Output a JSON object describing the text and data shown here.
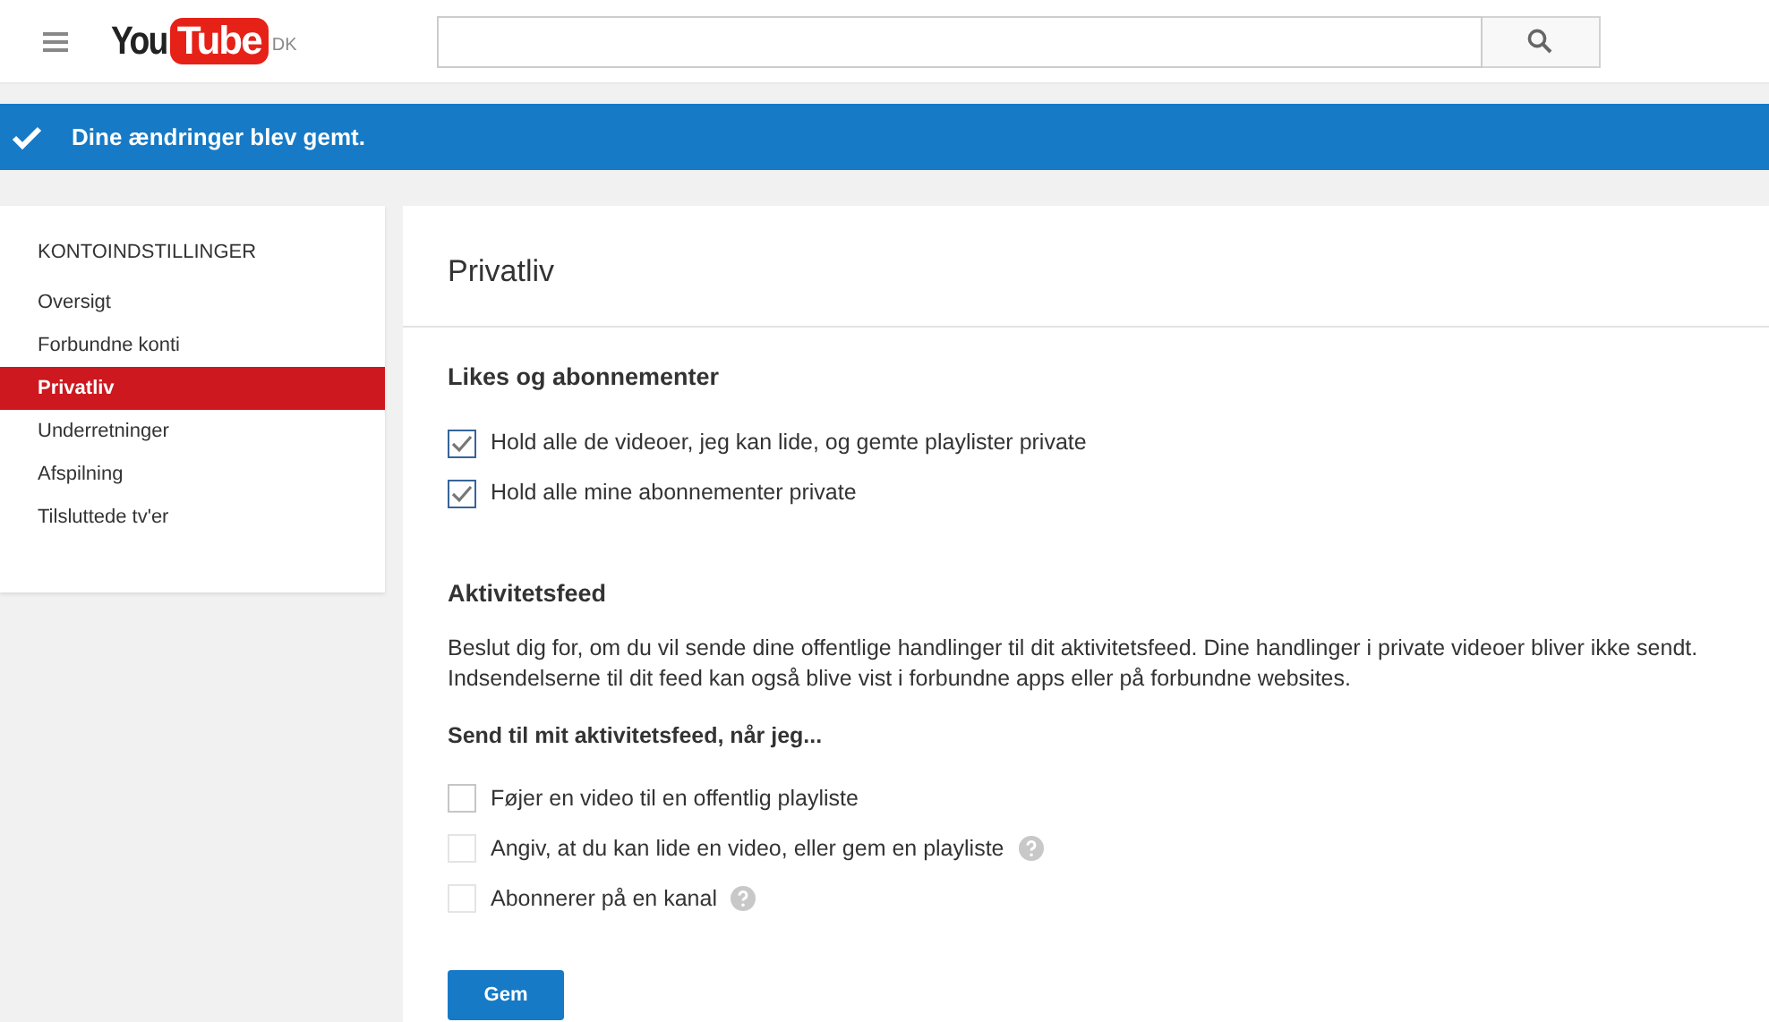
{
  "header": {
    "logo_you": "You",
    "logo_tube": "Tube",
    "logo_region": "DK"
  },
  "notice": {
    "text": "Dine ændringer blev gemt."
  },
  "sidebar": {
    "heading": "KONTOINDSTILLINGER",
    "items": [
      {
        "label": "Oversigt",
        "selected": false
      },
      {
        "label": "Forbundne konti",
        "selected": false
      },
      {
        "label": "Privatliv",
        "selected": true
      },
      {
        "label": "Underretninger",
        "selected": false
      },
      {
        "label": "Afspilning",
        "selected": false
      },
      {
        "label": "Tilsluttede tv'er",
        "selected": false
      }
    ]
  },
  "page_title": "Privatliv",
  "sections": [
    {
      "heading": "Likes og abonnementer",
      "options": [
        {
          "label": "Hold alle de videoer, jeg kan lide, og gemte playlister private",
          "checked": true,
          "disabled": false,
          "help": false
        },
        {
          "label": "Hold alle mine abonnementer private",
          "checked": true,
          "disabled": false,
          "help": false
        }
      ]
    },
    {
      "heading": "Aktivitetsfeed",
      "description": "Beslut dig for, om du vil sende dine offentlige handlinger til dit aktivitetsfeed. Dine handlinger i private videoer bliver ikke sendt. Indsendelserne til dit feed kan også blive vist i forbundne apps eller på forbundne websites.",
      "subheading": "Send til mit aktivitetsfeed, når jeg...",
      "options": [
        {
          "label": "Føjer en video til en offentlig playliste",
          "checked": false,
          "disabled": false,
          "help": false
        },
        {
          "label": "Angiv, at du kan lide en video, eller gem en playliste",
          "checked": false,
          "disabled": true,
          "help": true
        },
        {
          "label": "Abonnerer på en kanal",
          "checked": false,
          "disabled": true,
          "help": true
        }
      ]
    }
  ],
  "save_button": "Gem"
}
